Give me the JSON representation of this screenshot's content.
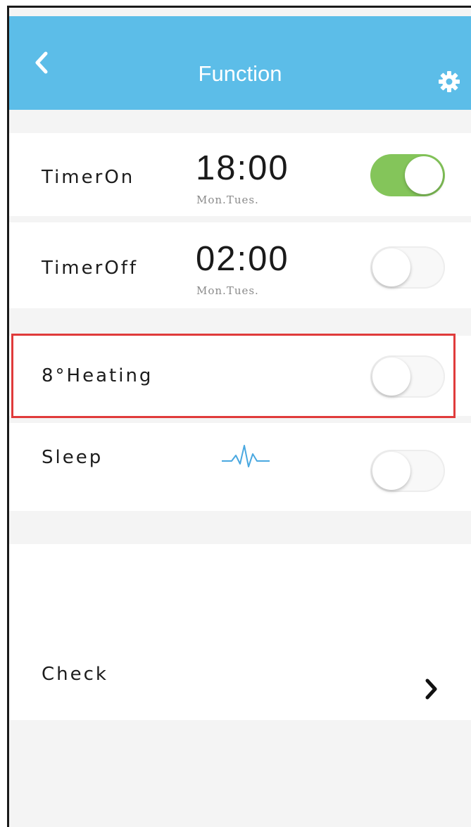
{
  "header": {
    "title": "Function",
    "background_color": "#5cbde8",
    "back_icon": "chevron-left-icon",
    "settings_icon": "gear-icon"
  },
  "timer_on": {
    "label": "TimerOn",
    "time": "18:00",
    "days": "Mon.Tues.",
    "toggle_on": true
  },
  "timer_off": {
    "label": "TimerOff",
    "time": "02:00",
    "days": "Mon.Tues.",
    "toggle_on": false
  },
  "heating": {
    "label": "8°Heating",
    "toggle_on": false,
    "highlight_color": "#e03b3b"
  },
  "sleep": {
    "label": "Sleep",
    "icon": "sleep-wave-icon",
    "toggle_on": false
  },
  "check": {
    "label": "Check",
    "icon": "chevron-right-icon"
  },
  "colors": {
    "toggle_on": "#84c55a",
    "accent_blue": "#5cbde8"
  }
}
